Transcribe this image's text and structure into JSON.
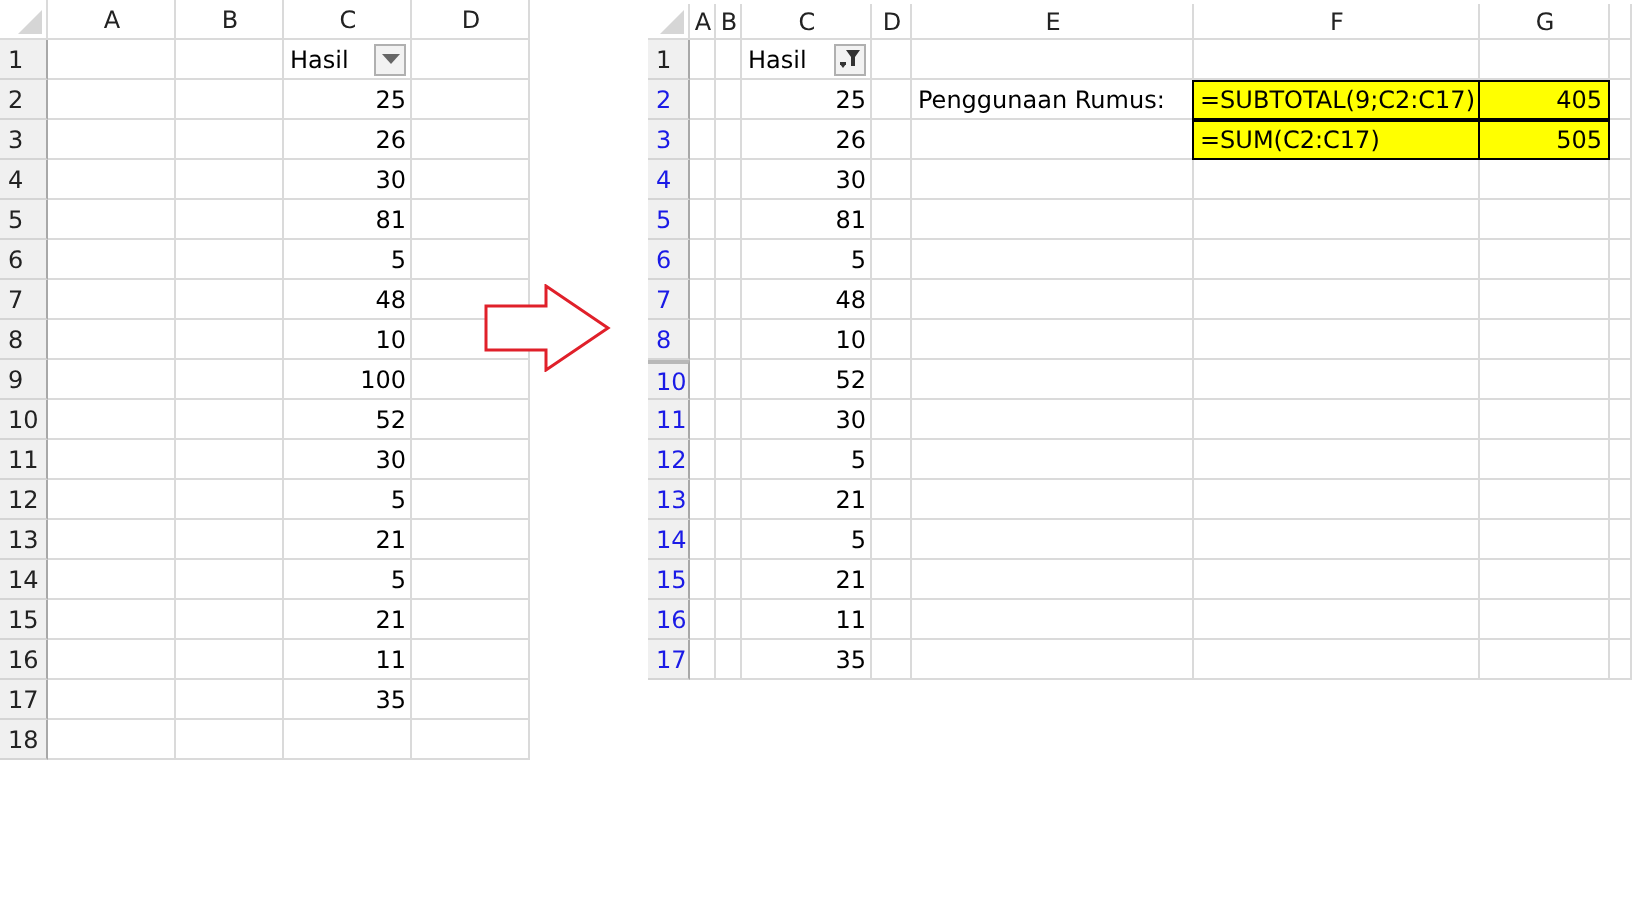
{
  "sheets": [
    {
      "filter_active": false,
      "columns": [
        "A",
        "B",
        "C",
        "D"
      ],
      "rows": [
        {
          "number": "1",
          "cells": [
            "",
            "",
            {
              "text": "Hasil",
              "kind": "header",
              "filter_button": true
            }
          ]
        },
        {
          "number": "2",
          "cells": [
            "",
            "",
            {
              "text": "25",
              "kind": "number"
            }
          ]
        },
        {
          "number": "3",
          "cells": [
            "",
            "",
            {
              "text": "26",
              "kind": "number"
            }
          ]
        },
        {
          "number": "4",
          "cells": [
            "",
            "",
            {
              "text": "30",
              "kind": "number"
            }
          ]
        },
        {
          "number": "5",
          "cells": [
            "",
            "",
            {
              "text": "81",
              "kind": "number"
            }
          ]
        },
        {
          "number": "6",
          "cells": [
            "",
            "",
            {
              "text": "5",
              "kind": "number"
            }
          ]
        },
        {
          "number": "7",
          "cells": [
            "",
            "",
            {
              "text": "48",
              "kind": "number"
            }
          ]
        },
        {
          "number": "8",
          "cells": [
            "",
            "",
            {
              "text": "10",
              "kind": "number"
            }
          ]
        },
        {
          "number": "9",
          "cells": [
            "",
            "",
            {
              "text": "100",
              "kind": "number"
            }
          ]
        },
        {
          "number": "10",
          "cells": [
            "",
            "",
            {
              "text": "52",
              "kind": "number"
            }
          ]
        },
        {
          "number": "11",
          "cells": [
            "",
            "",
            {
              "text": "30",
              "kind": "number"
            }
          ]
        },
        {
          "number": "12",
          "cells": [
            "",
            "",
            {
              "text": "5",
              "kind": "number"
            }
          ]
        },
        {
          "number": "13",
          "cells": [
            "",
            "",
            {
              "text": "21",
              "kind": "number"
            }
          ]
        },
        {
          "number": "14",
          "cells": [
            "",
            "",
            {
              "text": "5",
              "kind": "number"
            }
          ]
        },
        {
          "number": "15",
          "cells": [
            "",
            "",
            {
              "text": "21",
              "kind": "number"
            }
          ]
        },
        {
          "number": "16",
          "cells": [
            "",
            "",
            {
              "text": "11",
              "kind": "number"
            }
          ]
        },
        {
          "number": "17",
          "cells": [
            "",
            "",
            {
              "text": "35",
              "kind": "number"
            }
          ]
        },
        {
          "number": "18",
          "cells": []
        }
      ]
    },
    {
      "filter_active": true,
      "columns": [
        "A",
        "B",
        "C",
        "D",
        "E",
        "F",
        "G"
      ],
      "rows": [
        {
          "number": "1",
          "cells": [
            "",
            "",
            {
              "text": "Hasil",
              "kind": "header",
              "filter_button": true
            }
          ]
        },
        {
          "number": "2",
          "cells": [
            "",
            "",
            {
              "text": "25",
              "kind": "number"
            },
            "",
            {
              "text": "Penggunaan Rumus:",
              "kind": "text"
            },
            {
              "text": "=SUBTOTAL(9;C2:C17)",
              "kind": "text",
              "highlight": true
            },
            {
              "text": "405",
              "kind": "number",
              "highlight": true
            }
          ]
        },
        {
          "number": "3",
          "cells": [
            "",
            "",
            {
              "text": "26",
              "kind": "number"
            },
            "",
            "",
            {
              "text": "=SUM(C2:C17)",
              "kind": "text",
              "highlight": true
            },
            {
              "text": "505",
              "kind": "number",
              "highlight": true
            }
          ]
        },
        {
          "number": "4",
          "cells": [
            "",
            "",
            {
              "text": "30",
              "kind": "number"
            }
          ]
        },
        {
          "number": "5",
          "cells": [
            "",
            "",
            {
              "text": "81",
              "kind": "number"
            }
          ]
        },
        {
          "number": "6",
          "cells": [
            "",
            "",
            {
              "text": "5",
              "kind": "number"
            }
          ]
        },
        {
          "number": "7",
          "cells": [
            "",
            "",
            {
              "text": "48",
              "kind": "number"
            }
          ]
        },
        {
          "number": "8",
          "cells": [
            "",
            "",
            {
              "text": "10",
              "kind": "number"
            }
          ]
        },
        {
          "number": "10",
          "after_hidden": true,
          "cells": [
            "",
            "",
            {
              "text": "52",
              "kind": "number"
            }
          ]
        },
        {
          "number": "11",
          "cells": [
            "",
            "",
            {
              "text": "30",
              "kind": "number"
            }
          ]
        },
        {
          "number": "12",
          "cells": [
            "",
            "",
            {
              "text": "5",
              "kind": "number"
            }
          ]
        },
        {
          "number": "13",
          "cells": [
            "",
            "",
            {
              "text": "21",
              "kind": "number"
            }
          ]
        },
        {
          "number": "14",
          "cells": [
            "",
            "",
            {
              "text": "5",
              "kind": "number"
            }
          ]
        },
        {
          "number": "15",
          "cells": [
            "",
            "",
            {
              "text": "21",
              "kind": "number"
            }
          ]
        },
        {
          "number": "16",
          "cells": [
            "",
            "",
            {
              "text": "11",
              "kind": "number"
            }
          ]
        },
        {
          "number": "17",
          "cells": [
            "",
            "",
            {
              "text": "35",
              "kind": "number"
            }
          ]
        }
      ]
    }
  ]
}
